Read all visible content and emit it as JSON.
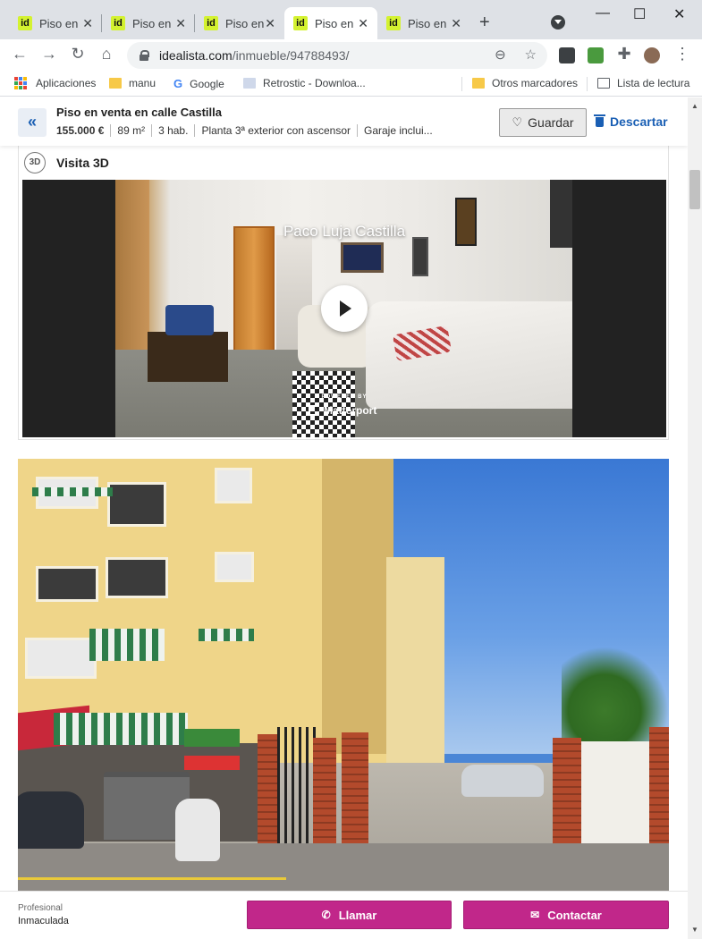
{
  "browser": {
    "tabs": [
      {
        "favicon": "id",
        "title": "Piso en"
      },
      {
        "favicon": "id",
        "title": "Piso en"
      },
      {
        "favicon": "id",
        "title": "Piso en"
      },
      {
        "favicon": "id",
        "title": "Piso en"
      },
      {
        "favicon": "id",
        "title": "Piso en"
      }
    ],
    "active_tab_index": 3,
    "url_host": "idealista.com",
    "url_path": "/inmueble/94788493/",
    "bookmarks": [
      {
        "label": "Aplicaciones",
        "icon": "apps-grid-icon"
      },
      {
        "label": "manu",
        "icon": "folder-icon"
      },
      {
        "label": "Google",
        "icon": "google-icon"
      },
      {
        "label": "Retrostic - Downloa...",
        "icon": "retrostic-icon"
      },
      {
        "label": "Otros marcadores",
        "icon": "folder-icon"
      },
      {
        "label": "Lista de lectura",
        "icon": "reading-list-icon"
      }
    ]
  },
  "listing": {
    "title": "Piso en venta en calle Castilla",
    "price": "155.000 €",
    "area": "89 m²",
    "rooms": "3 hab.",
    "floor": "Planta 3ª exterior con ascensor",
    "garage": "Garaje inclui...",
    "save_label": "Guardar",
    "discard_label": "Descartar"
  },
  "tour": {
    "badge": "3D",
    "label": "Visita 3D",
    "player_title": "Paco Luja Castilla",
    "powered_by": "POWERED BY",
    "provider": "Matterport"
  },
  "footer": {
    "advertiser_type": "Profesional",
    "advertiser_name": "Inmaculada",
    "call_label": "Llamar",
    "contact_label": "Contactar"
  },
  "colors": {
    "accent_blue": "#1a5fb4",
    "cta_magenta": "#c1278a",
    "idealista_green": "#d4f230"
  }
}
